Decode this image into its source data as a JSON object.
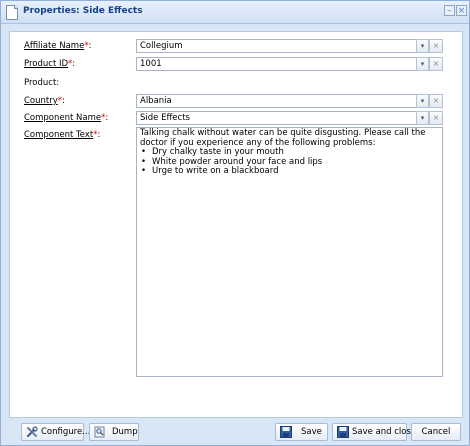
{
  "window": {
    "title": "Properties: Side Effects",
    "minimize_glyph": "–",
    "close_glyph": "×"
  },
  "fields": {
    "affiliate_name": {
      "label": "Affiliate Name",
      "required_mark": "*",
      "colon": ":",
      "value": "Collegium"
    },
    "product_id": {
      "label": "Product ID",
      "required_mark": "*",
      "colon": ":",
      "value": "1001"
    },
    "product": {
      "label": "Product:"
    },
    "country": {
      "label": "Country",
      "required_mark": "*",
      "colon": ":",
      "value": "Albania"
    },
    "component_name": {
      "label": "Component Name",
      "required_mark": "*",
      "colon": ":",
      "value": "Side Effects"
    },
    "component_text": {
      "label": "Component Text",
      "required_mark": "*",
      "colon": ":",
      "intro": "Talking chalk without water can be quite disgusting.  Please call the doctor if you experience any of the following problems:",
      "bullets": [
        "Dry chalky taste in your mouth",
        "White powder around your face and lips",
        "Urge to write on a blackboard"
      ]
    }
  },
  "combo": {
    "dropdown_glyph": "▾",
    "clear_glyph": "×"
  },
  "footer": {
    "configure_label": "Configure...",
    "dump_label": "Dump",
    "save_label": "Save",
    "save_close_label": "Save and close",
    "cancel_label": "Cancel"
  },
  "icons": {
    "title": "document-icon",
    "configure": "wrench-icon",
    "dump": "magnifier-icon",
    "save": "floppy-disk-icon",
    "save_close": "floppy-disk-icon"
  },
  "colors": {
    "accent": "#15428b",
    "required": "#d40000",
    "window_bg": "#d9e6f6"
  }
}
